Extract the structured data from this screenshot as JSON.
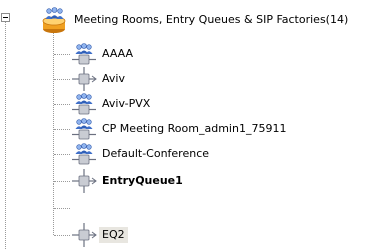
{
  "tree": {
    "root": {
      "label": "Meeting Rooms, Entry Queues & SIP Factories(14)",
      "icon": "database-people-icon",
      "expanded": true
    },
    "items": [
      {
        "label": "AAAA",
        "icon": "meeting-room-icon",
        "bold": false,
        "selected": false
      },
      {
        "label": "Aviv",
        "icon": "entry-queue-icon",
        "bold": false,
        "selected": false
      },
      {
        "label": "Aviv-PVX",
        "icon": "meeting-room-icon",
        "bold": false,
        "selected": false
      },
      {
        "label": "CP Meeting Room_admin1_75911",
        "icon": "meeting-room-icon",
        "bold": false,
        "selected": false
      },
      {
        "label": "Default-Conference",
        "icon": "meeting-room-icon",
        "bold": false,
        "selected": false
      },
      {
        "label": "EntryQueue1",
        "icon": "entry-queue-icon",
        "bold": true,
        "selected": false
      },
      {
        "label": "EQ2",
        "icon": "entry-queue-icon",
        "bold": false,
        "selected": true
      }
    ]
  },
  "colors": {
    "people_blue": "#3f6fc8",
    "people_head": "#8fb3ee",
    "db_orange": "#f0a020",
    "db_top": "#ffd270",
    "node_gray": "#8a8f99",
    "selection_bg": "#e8e6e0"
  }
}
